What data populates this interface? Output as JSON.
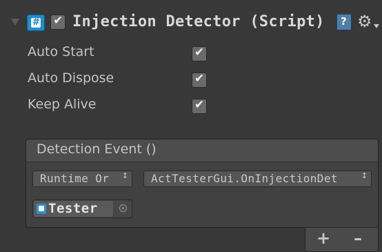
{
  "component": {
    "title": "Injection Detector (Script)",
    "enabled": true,
    "icons": {
      "foldout": "foldout-arrow-icon",
      "script": "csharp-script-icon",
      "help": "help-icon",
      "settings": "gear-icon"
    }
  },
  "properties": [
    {
      "label": "Auto Start",
      "checked": true
    },
    {
      "label": "Auto Dispose",
      "checked": true
    },
    {
      "label": "Keep Alive",
      "checked": true
    }
  ],
  "event": {
    "title": "Detection Event ()",
    "listener": {
      "call_state": "Runtime Or",
      "function": "ActTesterGui.OnInjectionDet",
      "target_object": "Tester"
    },
    "add_label": "+",
    "remove_label": "–"
  },
  "colors": {
    "background": "#383838",
    "text": "#c4c4c4",
    "script_icon": "#1e8ecb",
    "checkbox": "#6a6a6a"
  }
}
